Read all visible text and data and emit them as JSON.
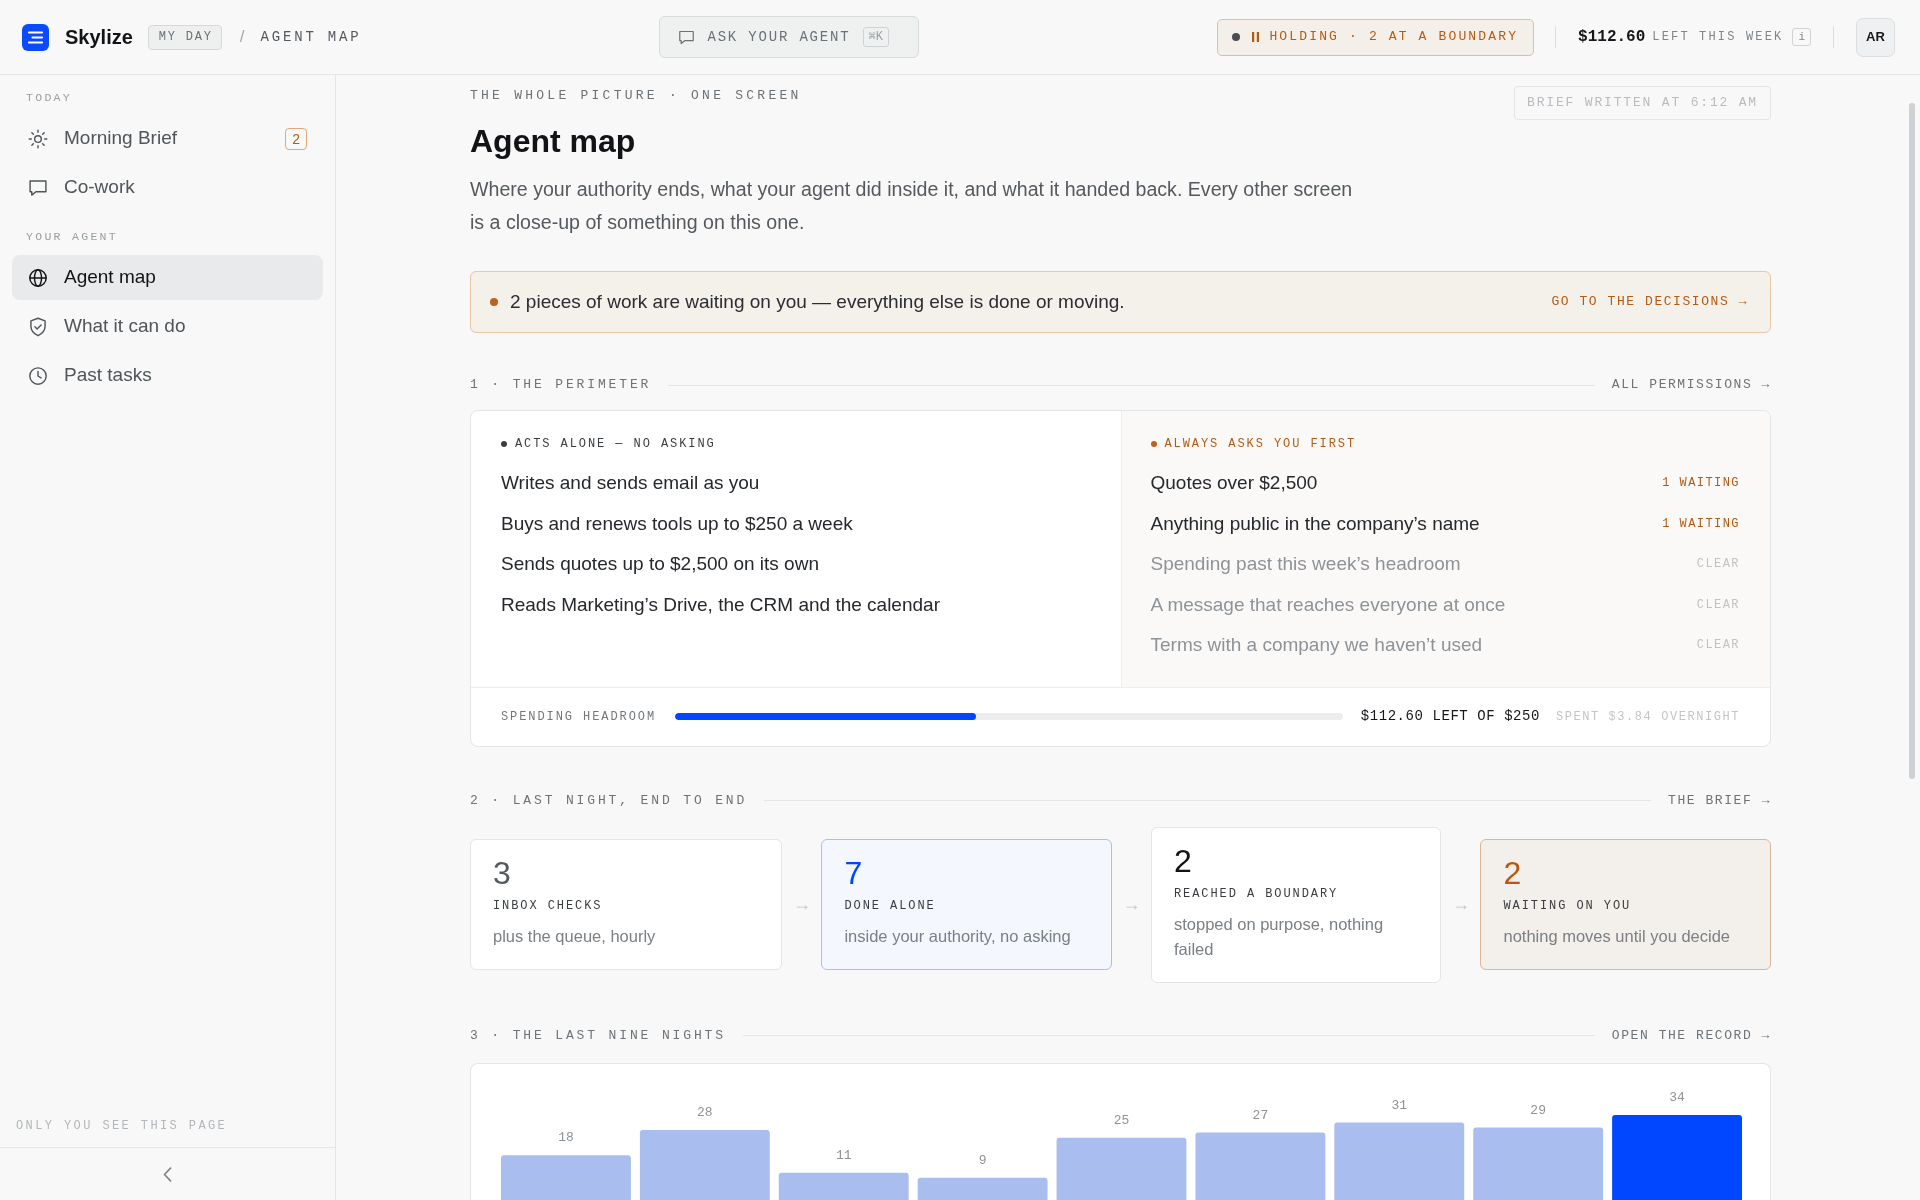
{
  "topbar": {
    "brand": "Skylize",
    "breadcrumbs": [
      {
        "label": "MY DAY",
        "kind": "link"
      },
      {
        "label": "/",
        "kind": "separator"
      },
      {
        "label": "AGENT MAP",
        "kind": "current"
      }
    ],
    "ask": {
      "label": "ASK YOUR AGENT",
      "shortcut": "⌘K"
    },
    "status": {
      "label": "HOLDING · 2 AT A BOUNDARY"
    },
    "budget": {
      "amount": "$112.60",
      "label": "LEFT THIS WEEK",
      "info": "i"
    },
    "avatar": "AR"
  },
  "sidebar": {
    "groups": [
      {
        "title": "TODAY",
        "items": [
          {
            "label": "Morning Brief",
            "badge": "2",
            "selected": false
          },
          {
            "label": "Co-work",
            "selected": false
          }
        ]
      },
      {
        "title": "YOUR AGENT",
        "items": [
          {
            "label": "Agent map",
            "selected": true
          },
          {
            "label": "What it can do",
            "selected": false
          },
          {
            "label": "Past tasks",
            "selected": false
          }
        ]
      }
    ],
    "footer": "ONLY YOU SEE THIS PAGE"
  },
  "header": {
    "eyebrow": "THE WHOLE PICTURE · ONE SCREEN",
    "title": "Agent map",
    "description": "Where your authority ends, what your agent did inside it, and what it handed back. Every other screen is a close-up of something on this one.",
    "stamp": "BRIEF WRITTEN AT 6:12 AM"
  },
  "alert": {
    "message": "2 pieces of work are waiting on you — everything else is done or moving.",
    "action": "GO TO THE DECISIONS →"
  },
  "perimeter": {
    "title": "1 · THE PERIMETER",
    "link": "ALL PERMISSIONS →",
    "columns": [
      {
        "kind": "alone",
        "heading": "ACTS ALONE — NO ASKING",
        "rows": [
          {
            "label": "Writes and sends email as you"
          },
          {
            "label": "Buys and renews tools up to $250 a week"
          },
          {
            "label": "Sends quotes up to $2,500 on its own"
          },
          {
            "label": "Reads Marketing’s Drive, the CRM and the calendar"
          }
        ]
      },
      {
        "kind": "asks",
        "heading": "ALWAYS ASKS YOU FIRST",
        "rows": [
          {
            "label": "Quotes over $2,500",
            "status": "1 WAITING",
            "kind": "waiting"
          },
          {
            "label": "Anything public in the company’s name",
            "status": "1 WAITING",
            "kind": "waiting"
          },
          {
            "label": "Spending past this week’s headroom",
            "status": "CLEAR",
            "kind": "clear"
          },
          {
            "label": "A message that reaches everyone at once",
            "status": "CLEAR",
            "kind": "clear"
          },
          {
            "label": "Terms with a company we haven’t used",
            "status": "CLEAR",
            "kind": "clear"
          }
        ]
      }
    ],
    "headroom": {
      "label": "SPENDING HEADROOM",
      "level": 0.45,
      "reading": "$112.60 LEFT OF $250",
      "note": "SPENT $3.84 OVERNIGHT"
    }
  },
  "last_night": {
    "title": "2 · LAST NIGHT, END TO END",
    "link": "THE BRIEF →",
    "steps": [
      {
        "kind": "neutral",
        "count": "3",
        "label": "INBOX CHECKS",
        "detail": "plus the queue, hourly"
      },
      {
        "kind": "done",
        "count": "7",
        "label": "DONE ALONE",
        "detail": "inside your authority, no asking"
      },
      {
        "kind": "boundary",
        "count": "2",
        "label": "REACHED A BOUNDARY",
        "detail": "stopped on purpose, nothing failed"
      },
      {
        "kind": "waiting",
        "count": "2",
        "label": "WAITING ON YOU",
        "detail": "nothing moves until you decide"
      }
    ],
    "connectors": [
      "→",
      "→",
      "→"
    ]
  },
  "nights": {
    "title": "3 · THE LAST NINE NIGHTS",
    "link": "OPEN THE RECORD →",
    "chart_data": {
      "type": "bar",
      "categories": [
        null,
        null,
        null,
        null,
        null,
        null,
        null,
        null,
        null
      ],
      "stacked": true,
      "data_labels": true,
      "series": [
        {
          "color": "#a9bdee",
          "values": [
            18,
            28,
            11,
            9,
            25,
            27,
            31,
            29,
            null
          ]
        },
        {
          "color": "#0047ff",
          "values": [
            null,
            null,
            null,
            null,
            null,
            null,
            null,
            null,
            34
          ]
        }
      ]
    }
  }
}
